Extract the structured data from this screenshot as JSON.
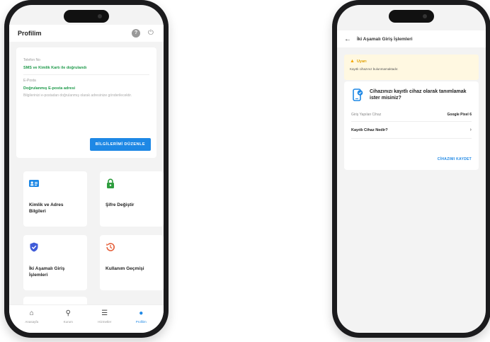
{
  "left": {
    "header": {
      "title": "Profilim"
    },
    "info": {
      "phone_label": "Telefon No",
      "phone_value": "SMS ve Kimlik Kartı ile doğrulandı",
      "email_label": "E-Posta",
      "email_value": "Doğrulanmış E-posta adresi",
      "hint": "Bilgilerinizi e-postadan doğrulanmış olarak adresinize gönderilecektir.",
      "edit_button": "BİLGİLERİMİ DÜZENLE"
    },
    "tiles": [
      {
        "label": "Kimlik ve Adres Bilgileri",
        "icon": "id-card-icon",
        "color": "#1e88e5"
      },
      {
        "label": "Şifre Değiştir",
        "icon": "lock-icon",
        "color": "#2e9d3e"
      },
      {
        "label": "İki Aşamalı Giriş İşlemleri",
        "icon": "shield-check-icon",
        "color": "#3f5bd8"
      },
      {
        "label": "Kullanım Geçmişi",
        "icon": "history-icon",
        "color": "#e5603b"
      }
    ],
    "nav": [
      {
        "label": "Anasayfa",
        "icon": "home-icon"
      },
      {
        "label": "Kurum",
        "icon": "search-icon"
      },
      {
        "label": "Hizmetler",
        "icon": "list-icon"
      },
      {
        "label": "Profilim",
        "icon": "user-icon"
      }
    ]
  },
  "right": {
    "header": {
      "title": "İki Aşamalı Giriş İşlemleri"
    },
    "warning": {
      "title": "Uyarı",
      "text": "Kayıtlı cihazınız bulunmamaktadır."
    },
    "device": {
      "question": "Cihazınızı kayıtlı cihaz olarak tanımlamak ister misiniz?",
      "key": "Giriş Yapılan Cihaz",
      "value": "Google Pixel 6",
      "link": "Kayıtlı Cihaz Nedir?",
      "save": "CİHAZIMI KAYDET"
    }
  }
}
